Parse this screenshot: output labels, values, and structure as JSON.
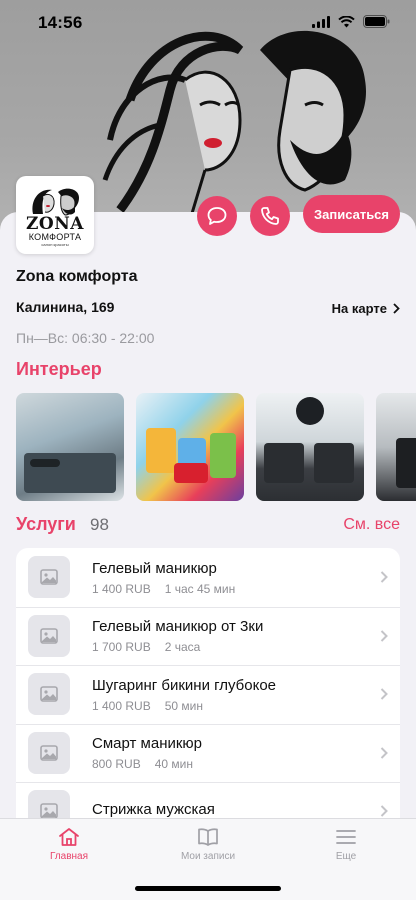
{
  "status_bar": {
    "time": "14:56"
  },
  "salon": {
    "logo_brand": "ZONA",
    "logo_sub": "КОМФОРТА",
    "logo_tag": "салон красоты",
    "name": "Zona комфорта",
    "address": "Калинина, 169",
    "map_label": "На карте",
    "hours": "Пн—Вс: 06:30 - 22:00"
  },
  "actions": {
    "book_label": "Записаться"
  },
  "interior": {
    "title": "Интерьер"
  },
  "services": {
    "title": "Услуги",
    "count": "98",
    "see_all": "См. все",
    "items": [
      {
        "name": "Гелевый маникюр",
        "price": "1 400 RUB",
        "duration": "1 час 45 мин"
      },
      {
        "name": "Гелевый маникюр от 3ки",
        "price": "1 700 RUB",
        "duration": "2 часа"
      },
      {
        "name": "Шугаринг бикини глубокое",
        "price": "1 400 RUB",
        "duration": "50 мин"
      },
      {
        "name": "Смарт маникюр",
        "price": "800 RUB",
        "duration": "40 мин"
      },
      {
        "name": "Стрижка мужская",
        "price": "",
        "duration": ""
      }
    ]
  },
  "tabs": [
    {
      "label": "Главная",
      "icon": "home-icon",
      "active": true
    },
    {
      "label": "Мои записи",
      "icon": "book-icon",
      "active": false
    },
    {
      "label": "Еще",
      "icon": "menu-icon",
      "active": false
    }
  ],
  "colors": {
    "accent": "#e8436a",
    "inactive": "#a0a0a6"
  }
}
